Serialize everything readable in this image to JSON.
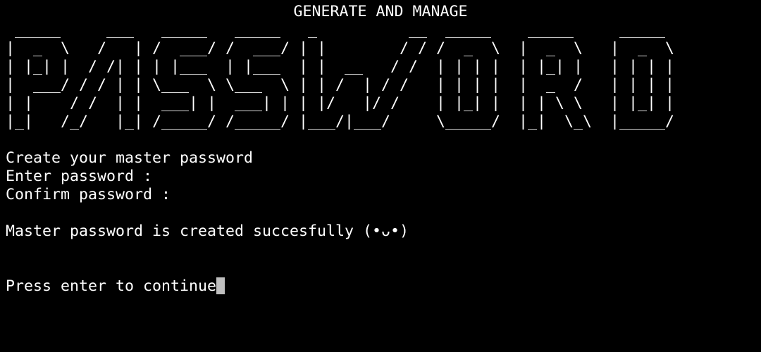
{
  "terminal": {
    "heading": "GENERATE AND MANAGE",
    "banner": " _____     ___   _____   _____   _          __  _____    _____     _____\n|  _  \\   /   | /  ___/ /  ___/ | |        / / /  _  \\  |  _  \\   |  _  \\\n| |_| |  / /| | | |___  | |___  | |  __   / /  | | | |  | |_| |   | | | |\n|  ___/ / / | | \\___  \\ \\___  \\ | | /  | / /   | | | |  |  _  /   | | | |\n| |    / /  | |  ___| |  ___| | | |/   |/ /    | |_| |  | | \\ \\   | |_| |\n|_|   /_/   |_| /_____/ /_____/ |___/|___/     \\_____/  |_|  \\_\\  |_____/",
    "lines": [
      "Create your master password",
      "Enter password :",
      "Confirm password :",
      "",
      "Master password is created succesfully (•ᴗ•)",
      "",
      "",
      "Press enter to continue"
    ],
    "colors": {
      "background": "#000000",
      "foreground": "#ffffff",
      "cursor": "#bfbfbf"
    }
  }
}
